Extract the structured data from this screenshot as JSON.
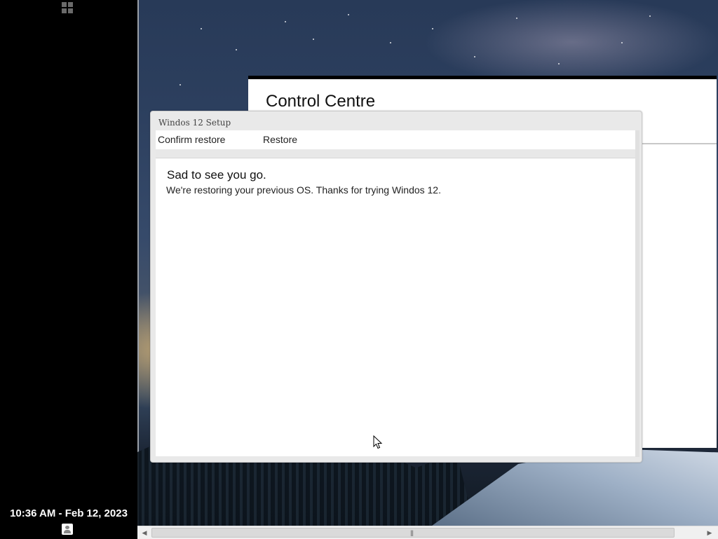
{
  "taskbar": {
    "clock_text": "10:36 AM - Feb 12, 2023"
  },
  "background_window": {
    "title": "Control Centre"
  },
  "setup_dialog": {
    "title": "Windos 12 Setup",
    "steps": [
      {
        "label": "Confirm restore"
      },
      {
        "label": "Restore"
      }
    ],
    "heading": "Sad to see you go.",
    "message": "We're restoring your previous OS. Thanks for trying Windos 12."
  },
  "icons": {
    "start": "start-menu-icon",
    "user": "user-icon",
    "cursor": "mouse-cursor-icon",
    "scroll_left": "scroll-left-icon",
    "scroll_right": "scroll-right-icon"
  },
  "colors": {
    "taskbar": "#000000",
    "dialog_frame": "#e9e9e9",
    "content_bg": "#ffffff"
  }
}
